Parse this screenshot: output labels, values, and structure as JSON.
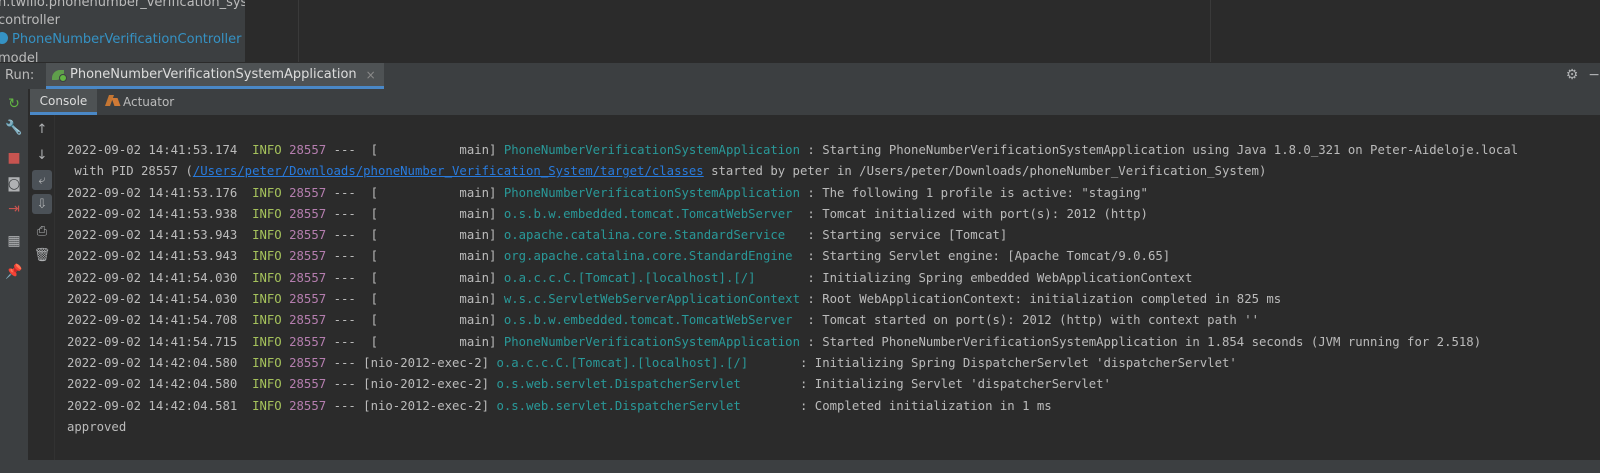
{
  "project_tree": {
    "rows": [
      {
        "label": "n.twilio.phonenumber_verification_syster",
        "selected": false
      },
      {
        "label": "controller",
        "selected": false
      },
      {
        "label": "PhoneNumberVerificationController",
        "selected": true
      },
      {
        "label": "model",
        "selected": false
      }
    ]
  },
  "run_panel": {
    "label": "Run:",
    "tab_label": "PhoneNumberVerificationSystemApplication",
    "close_glyph": "×",
    "settings_glyph": "⚙",
    "minimize_glyph": "−",
    "sub_tabs": [
      {
        "label": "Console",
        "active": true
      },
      {
        "label": "Actuator",
        "active": false
      }
    ]
  },
  "left_toolbar_icons": [
    {
      "name": "rerun-icon",
      "glyph": "↻",
      "color": "#62b543"
    },
    {
      "name": "wrench-icon",
      "glyph": "🔧",
      "color": "#afb1b3"
    },
    {
      "name": "stop-icon",
      "glyph": "■",
      "color": "#c75450"
    },
    {
      "name": "camera-icon",
      "glyph": "◙",
      "color": "#afb1b3"
    },
    {
      "name": "exit-icon",
      "glyph": "⇥",
      "color": "#c75450"
    },
    {
      "name": "layout-icon",
      "glyph": "▦",
      "color": "#afb1b3"
    },
    {
      "name": "pin-icon",
      "glyph": "📌",
      "color": "#afb1b3"
    }
  ],
  "console_toolbar_icons": [
    {
      "name": "scroll-up-icon",
      "glyph": "↑",
      "active": false
    },
    {
      "name": "scroll-down-icon",
      "glyph": "↓",
      "active": false
    },
    {
      "name": "soft-wrap-icon",
      "glyph": "⤶",
      "active": true
    },
    {
      "name": "scroll-to-end-icon",
      "glyph": "⇩",
      "active": true
    },
    {
      "name": "print-icon",
      "glyph": "⎙",
      "active": false
    },
    {
      "name": "trash-icon",
      "glyph": "🗑",
      "active": false
    }
  ],
  "log": [
    {
      "ts": "2022-09-02 14:41:53.174",
      "level": "INFO",
      "pid": "28557",
      "thread": "---  [           main]",
      "logger": "PhoneNumberVerificationSystemApplication",
      "pad": " ",
      "message": ": Starting PhoneNumberVerificationSystemApplication using Java 1.8.0_321 on Peter-Aideloje.local"
    },
    {
      "continuation": true,
      "prefix": " with PID 28557 (",
      "link": "/Users/peter/Downloads/phoneNumber_Verification_System/target/classes",
      "suffix": " started by peter in /Users/peter/Downloads/phoneNumber_Verification_System)"
    },
    {
      "ts": "2022-09-02 14:41:53.176",
      "level": "INFO",
      "pid": "28557",
      "thread": "---  [           main]",
      "logger": "PhoneNumberVerificationSystemApplication",
      "pad": " ",
      "message": ": The following 1 profile is active: \"staging\""
    },
    {
      "ts": "2022-09-02 14:41:53.938",
      "level": "INFO",
      "pid": "28557",
      "thread": "---  [           main]",
      "logger": "o.s.b.w.embedded.tomcat.TomcatWebServer",
      "pad": "  ",
      "message": ": Tomcat initialized with port(s): 2012 (http)"
    },
    {
      "ts": "2022-09-02 14:41:53.943",
      "level": "INFO",
      "pid": "28557",
      "thread": "---  [           main]",
      "logger": "o.apache.catalina.core.StandardService",
      "pad": "   ",
      "message": ": Starting service [Tomcat]"
    },
    {
      "ts": "2022-09-02 14:41:53.943",
      "level": "INFO",
      "pid": "28557",
      "thread": "---  [           main]",
      "logger": "org.apache.catalina.core.StandardEngine",
      "pad": "  ",
      "message": ": Starting Servlet engine: [Apache Tomcat/9.0.65]"
    },
    {
      "ts": "2022-09-02 14:41:54.030",
      "level": "INFO",
      "pid": "28557",
      "thread": "---  [           main]",
      "logger": "o.a.c.c.C.[Tomcat].[localhost].[/]",
      "pad": "       ",
      "message": ": Initializing Spring embedded WebApplicationContext"
    },
    {
      "ts": "2022-09-02 14:41:54.030",
      "level": "INFO",
      "pid": "28557",
      "thread": "---  [           main]",
      "logger": "w.s.c.ServletWebServerApplicationContext",
      "pad": " ",
      "message": ": Root WebApplicationContext: initialization completed in 825 ms"
    },
    {
      "ts": "2022-09-02 14:41:54.708",
      "level": "INFO",
      "pid": "28557",
      "thread": "---  [           main]",
      "logger": "o.s.b.w.embedded.tomcat.TomcatWebServer",
      "pad": "  ",
      "message": ": Tomcat started on port(s): 2012 (http) with context path ''"
    },
    {
      "ts": "2022-09-02 14:41:54.715",
      "level": "INFO",
      "pid": "28557",
      "thread": "---  [           main]",
      "logger": "PhoneNumberVerificationSystemApplication",
      "pad": " ",
      "message": ": Started PhoneNumberVerificationSystemApplication in 1.854 seconds (JVM running for 2.518)"
    },
    {
      "ts": "2022-09-02 14:42:04.580",
      "level": "INFO",
      "pid": "28557",
      "thread": "--- [nio-2012-exec-2]",
      "logger": "o.a.c.c.C.[Tomcat].[localhost].[/]",
      "pad": "       ",
      "message": ": Initializing Spring DispatcherServlet 'dispatcherServlet'"
    },
    {
      "ts": "2022-09-02 14:42:04.580",
      "level": "INFO",
      "pid": "28557",
      "thread": "--- [nio-2012-exec-2]",
      "logger": "o.s.web.servlet.DispatcherServlet",
      "pad": "        ",
      "message": ": Initializing Servlet 'dispatcherServlet'"
    },
    {
      "ts": "2022-09-02 14:42:04.581",
      "level": "INFO",
      "pid": "28557",
      "thread": "--- [nio-2012-exec-2]",
      "logger": "o.s.web.servlet.DispatcherServlet",
      "pad": "        ",
      "message": ": Completed initialization in 1 ms"
    },
    {
      "plain": "approved"
    }
  ]
}
